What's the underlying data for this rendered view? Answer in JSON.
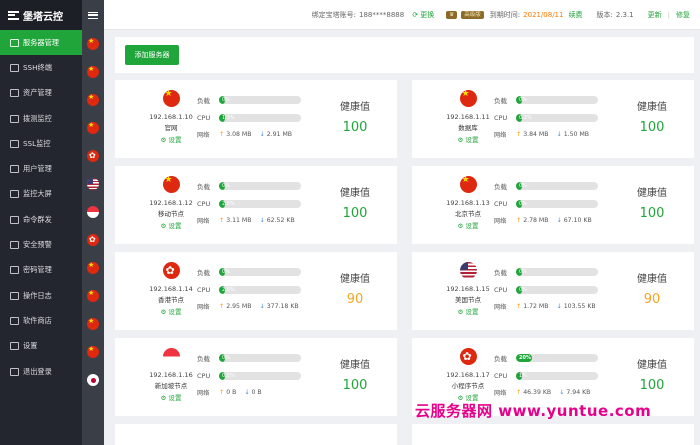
{
  "app": {
    "title": "堡塔云控"
  },
  "nav": [
    {
      "label": "服务器管理",
      "active": true
    },
    {
      "label": "SSH终端"
    },
    {
      "label": "资产管理"
    },
    {
      "label": "拨测监控"
    },
    {
      "label": "SSL监控"
    },
    {
      "label": "用户管理"
    },
    {
      "label": "监控大屏"
    },
    {
      "label": "命令群发"
    },
    {
      "label": "安全预警"
    },
    {
      "label": "密码管理"
    },
    {
      "label": "操作日志"
    },
    {
      "label": "软件商店"
    },
    {
      "label": "设置"
    },
    {
      "label": "退出登录"
    }
  ],
  "flag_list": [
    "cn",
    "cn",
    "cn",
    "cn",
    "hk",
    "us",
    "sg",
    "hk",
    "cn",
    "cn",
    "cn",
    "cn",
    "jp"
  ],
  "topbar": {
    "bind_label": "绑定宝塔账号:",
    "account": "188****8888",
    "change": "更换",
    "tier": "高级版",
    "expire_label": "到期时间:",
    "expire_date": "2021/08/11",
    "renew": "续费",
    "version_label": "版本:",
    "version": "2.3.1",
    "update": "更新",
    "repair": "修复"
  },
  "toolbar": {
    "add_label": "添加服务器"
  },
  "labels": {
    "load": "负载",
    "cpu": "CPU",
    "net": "网络",
    "health": "健康值",
    "settings": "设置"
  },
  "servers": [
    {
      "ip": "192.168.1.10",
      "name": "官网",
      "flag": "cn",
      "load": "0%",
      "load_v": 0,
      "cpu": "1.3%",
      "cpu_v": 1.3,
      "up": "3.08 MB",
      "down": "2.91 MB",
      "health": "100",
      "hcolor": "hg"
    },
    {
      "ip": "192.168.1.11",
      "name": "数据库",
      "flag": "cn",
      "load": "0%",
      "load_v": 0,
      "cpu": "0.2%",
      "cpu_v": 0.2,
      "up": "3.84 MB",
      "down": "1.50 MB",
      "health": "100",
      "hcolor": "hg"
    },
    {
      "ip": "192.168.1.12",
      "name": "移动节点",
      "flag": "cn",
      "load": "0%",
      "load_v": 0,
      "cpu": "2.5%",
      "cpu_v": 2.5,
      "up": "3.11 MB",
      "down": "62.52 KB",
      "health": "100",
      "hcolor": "hg"
    },
    {
      "ip": "192.168.1.13",
      "name": "北京节点",
      "flag": "cn",
      "load": "0%",
      "load_v": 0,
      "cpu": "0%",
      "cpu_v": 0,
      "up": "2.78 MB",
      "down": "67.10 KB",
      "health": "100",
      "hcolor": "hg"
    },
    {
      "ip": "192.168.1.14",
      "name": "香港节点",
      "flag": "hk",
      "load": "0%",
      "load_v": 0,
      "cpu": "2.5%",
      "cpu_v": 2.5,
      "up": "2.95 MB",
      "down": "377.18 KB",
      "health": "90",
      "hcolor": "ho"
    },
    {
      "ip": "192.168.1.15",
      "name": "美国节点",
      "flag": "us",
      "load": "0%",
      "load_v": 0,
      "cpu": "0%",
      "cpu_v": 0,
      "up": "1.72 MB",
      "down": "103.55 KB",
      "health": "90",
      "hcolor": "ho"
    },
    {
      "ip": "192.168.1.16",
      "name": "新加坡节点",
      "flag": "sg",
      "load": "0%",
      "load_v": 0,
      "cpu": "0.5%",
      "cpu_v": 0.5,
      "up": "0 B",
      "down": "0 B",
      "health": "100",
      "hcolor": "hg"
    },
    {
      "ip": "192.168.1.17",
      "name": "小程序节点",
      "flag": "hk",
      "load": "20%",
      "load_v": 20,
      "cpu": "1%",
      "cpu_v": 1,
      "up": "46.39 KB",
      "down": "7.94 KB",
      "health": "100",
      "hcolor": "hg"
    }
  ],
  "watermark": "云服务器网 www.yuntue.com",
  "colors": {
    "accent": "#20a53a",
    "sidebar": "#23262e",
    "warn": "#f5a623"
  }
}
